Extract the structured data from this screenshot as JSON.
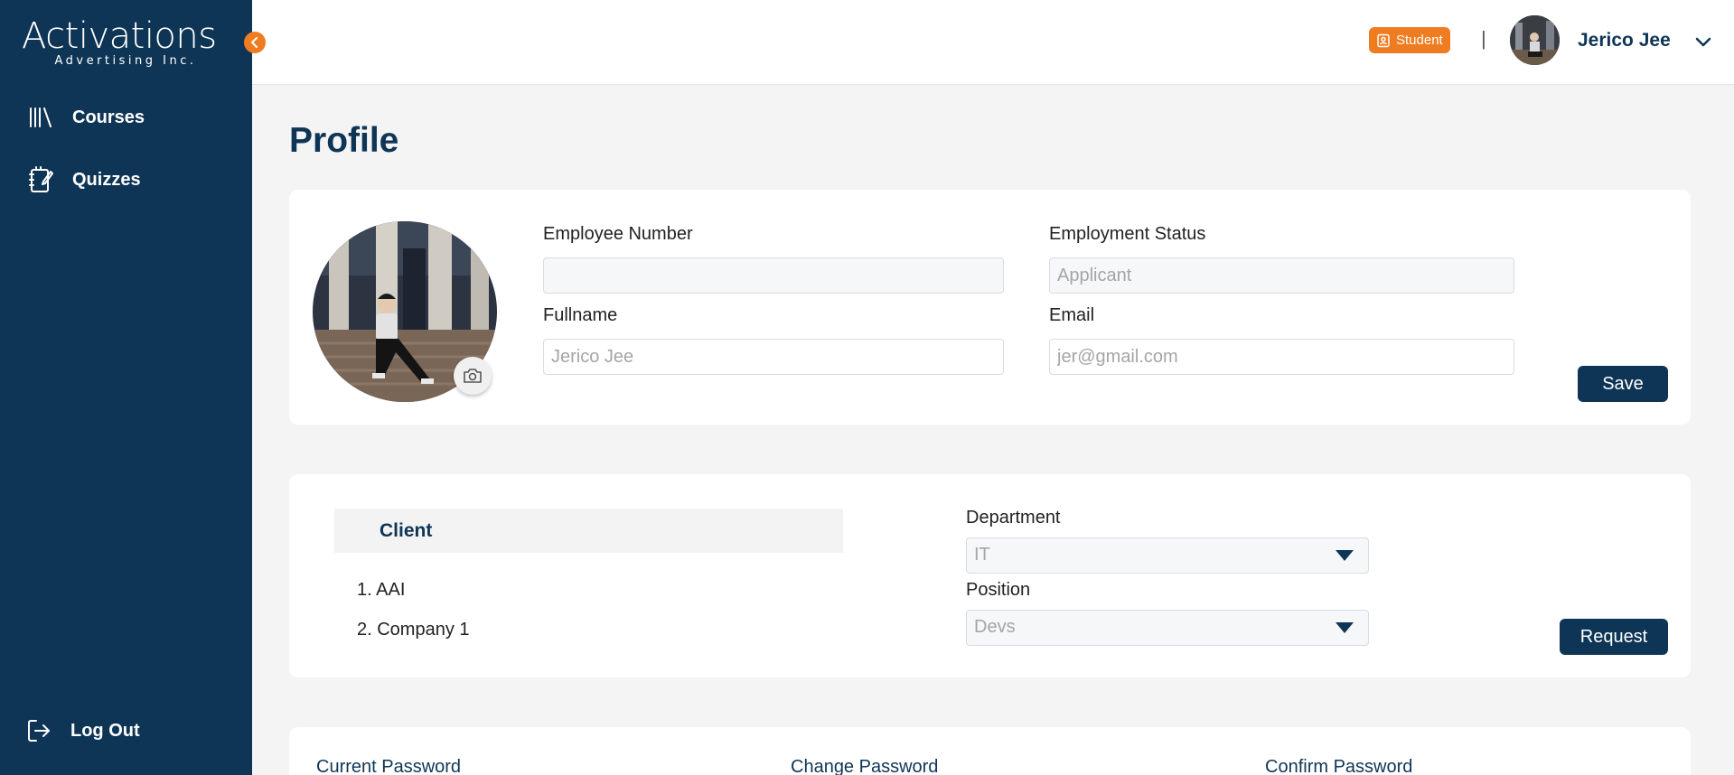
{
  "colors": {
    "navy": "#0f3556",
    "accent": "#f07c22",
    "background": "#f4f4f4"
  },
  "sidebar": {
    "logo_main": "Activations",
    "logo_sub": "Advertising Inc.",
    "collapse_icon": "chevron-left-icon",
    "items": [
      {
        "label": "Courses",
        "icon": "library-icon"
      },
      {
        "label": "Quizzes",
        "icon": "notebook-edit-icon"
      }
    ],
    "logout_label": "Log Out"
  },
  "header": {
    "role_badge": "Student",
    "separator": "|",
    "username": "Jerico Jee"
  },
  "page": {
    "title": "Profile"
  },
  "profile": {
    "employee_number": {
      "label": "Employee Number",
      "value": "",
      "placeholder": ""
    },
    "employment_status": {
      "label": "Employment Status",
      "value": "",
      "placeholder": "Applicant"
    },
    "fullname": {
      "label": "Fullname",
      "value": "",
      "placeholder": "Jerico Jee"
    },
    "email": {
      "label": "Email",
      "value": "",
      "placeholder": "jer@gmail.com"
    },
    "save_label": "Save"
  },
  "assignment": {
    "client_header": "Client",
    "clients": [
      "1. AAI",
      "2. Company 1"
    ],
    "department": {
      "label": "Department",
      "value": "IT"
    },
    "position": {
      "label": "Position",
      "value": "Devs"
    },
    "request_label": "Request"
  },
  "password": {
    "current_label": "Current Password",
    "change_label": "Change Password",
    "confirm_label": "Confirm Password"
  }
}
